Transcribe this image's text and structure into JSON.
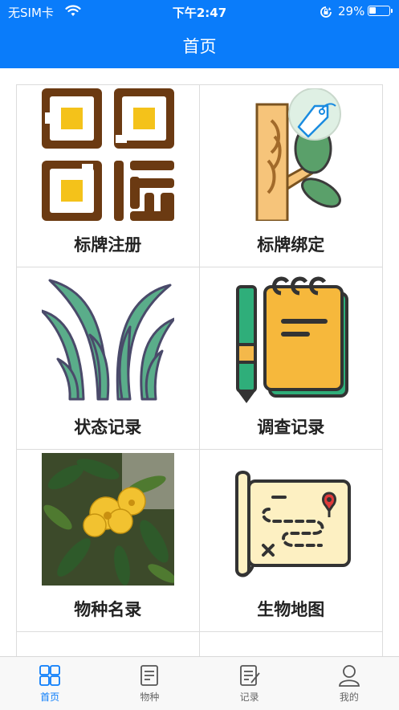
{
  "status_bar": {
    "carrier": "无SIM卡",
    "time": "下午2:47",
    "battery": "29%"
  },
  "header": {
    "title": "首页"
  },
  "menu": {
    "items": [
      {
        "label": "标牌注册",
        "icon": "qr-code-icon"
      },
      {
        "label": "标牌绑定",
        "icon": "tree-tag-icon"
      },
      {
        "label": "状态记录",
        "icon": "plant-leaves-icon"
      },
      {
        "label": "调查记录",
        "icon": "notebook-pen-icon"
      },
      {
        "label": "物种名录",
        "icon": "yellow-camellia-photo"
      },
      {
        "label": "生物地图",
        "icon": "treasure-map-icon"
      }
    ]
  },
  "tabbar": {
    "tabs": [
      {
        "label": "首页",
        "icon": "grid-icon",
        "active": true
      },
      {
        "label": "物种",
        "icon": "document-icon",
        "active": false
      },
      {
        "label": "记录",
        "icon": "record-icon",
        "active": false
      },
      {
        "label": "我的",
        "icon": "user-icon",
        "active": false
      }
    ]
  },
  "colors": {
    "brand": "#0a7cfa",
    "tab_inactive": "#666666"
  }
}
